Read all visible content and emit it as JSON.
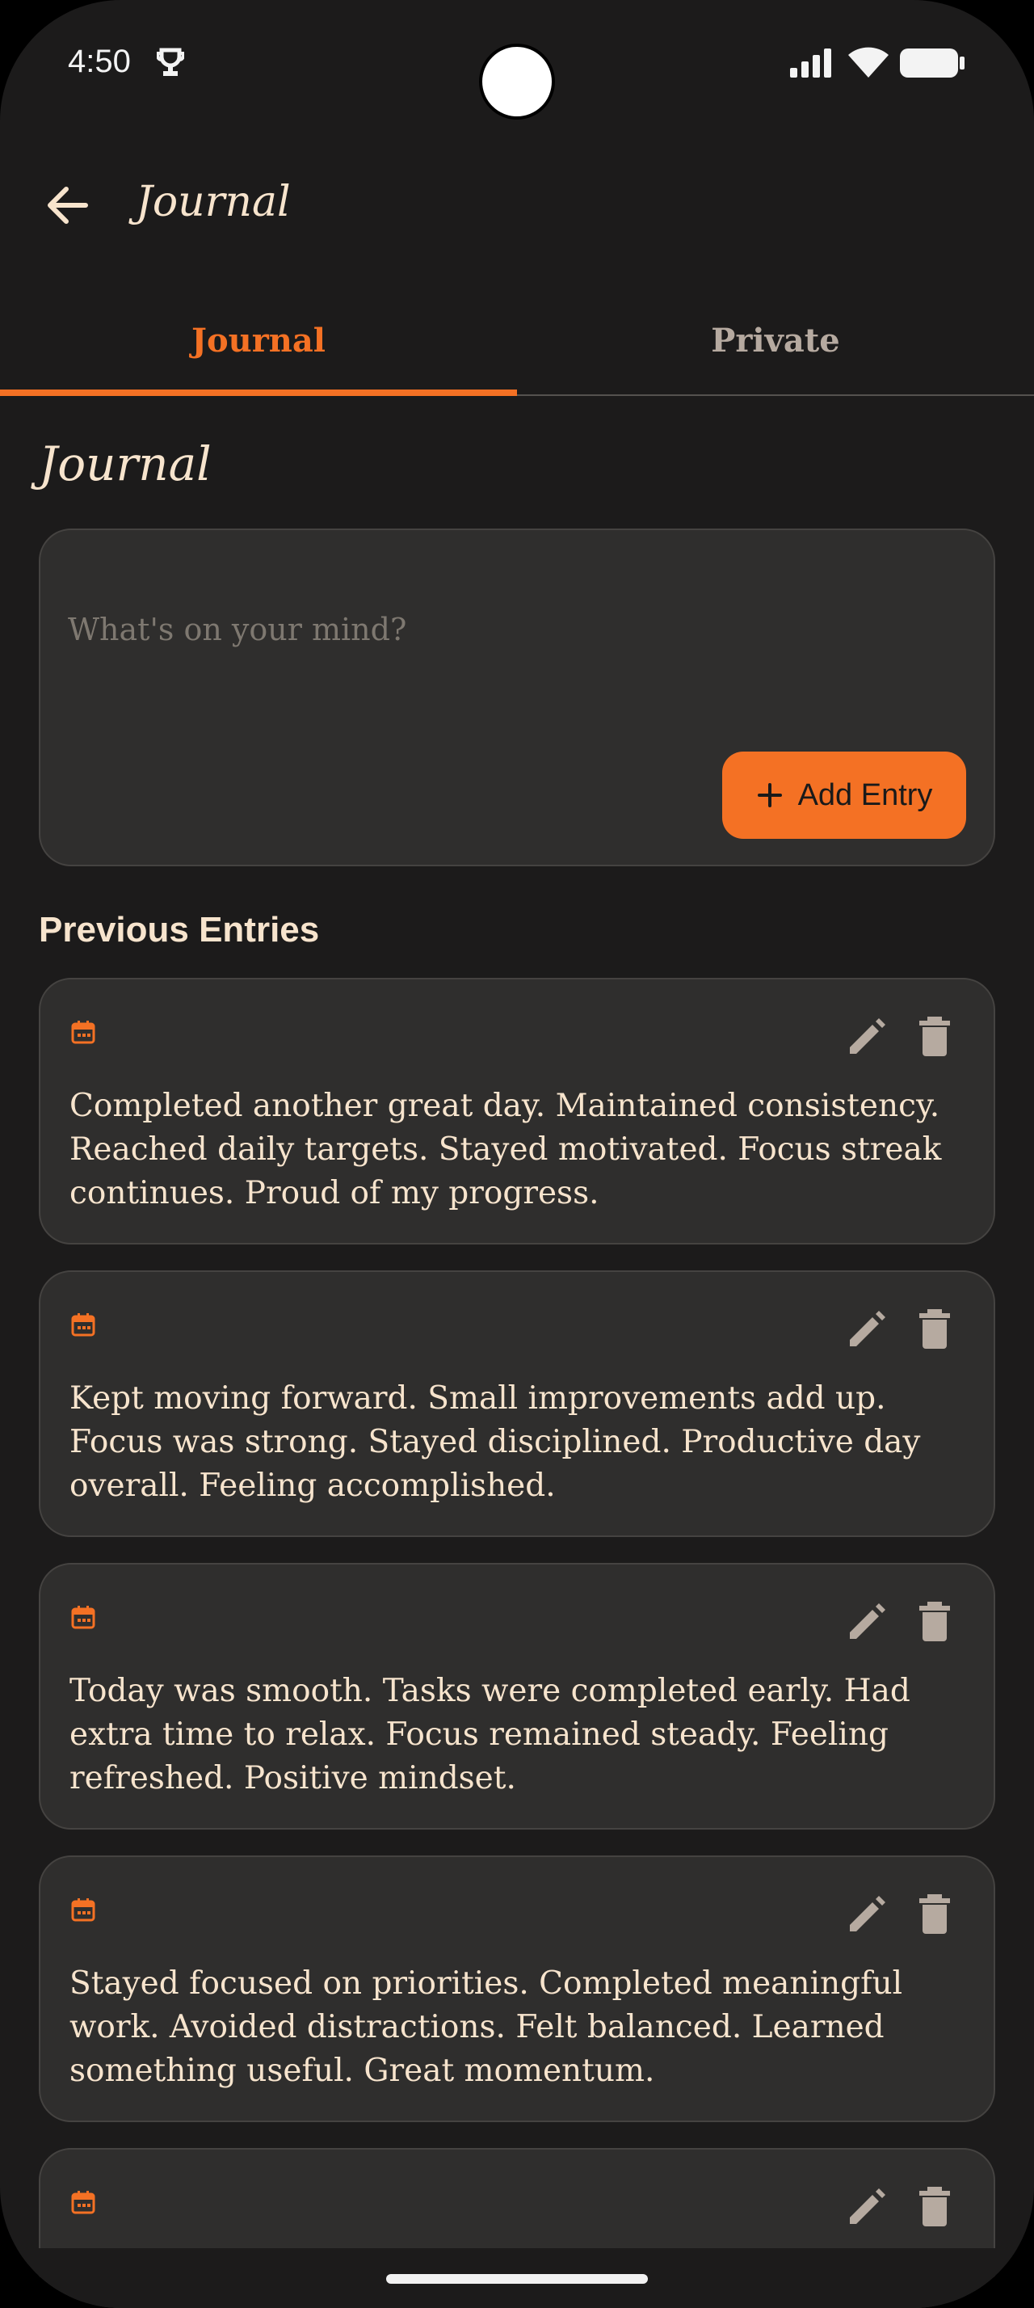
{
  "status_bar": {
    "time": "4:50"
  },
  "app_bar": {
    "title": "Journal",
    "back_icon": "arrow-back-icon"
  },
  "tabs": [
    {
      "label": "Journal",
      "active": true
    },
    {
      "label": "Private",
      "active": false
    }
  ],
  "section_title": "Journal",
  "composer": {
    "placeholder": "What's on your mind?",
    "value": "",
    "add_button_label": "Add Entry"
  },
  "previous_entries": {
    "title": "Previous Entries",
    "items": [
      {
        "text": "Completed another great day. Maintained consistency. Reached daily targets. Stayed motivated. Focus streak continues. Proud of my progress."
      },
      {
        "text": "Kept moving forward. Small improvements add up. Focus was strong. Stayed disciplined. Productive day overall. Feeling accomplished."
      },
      {
        "text": "Today was smooth. Tasks were completed early. Had extra time to relax. Focus remained steady. Feeling refreshed. Positive mindset."
      },
      {
        "text": "Stayed focused on priorities. Completed meaningful work. Avoided distractions. Felt balanced. Learned something useful. Great momentum."
      },
      {
        "text": ""
      }
    ]
  },
  "colors": {
    "background": "#1c1b1b",
    "card": "#2f2e2d",
    "accent": "#f47124",
    "text": "#f7e4cd",
    "muted": "#b6aaa0"
  }
}
